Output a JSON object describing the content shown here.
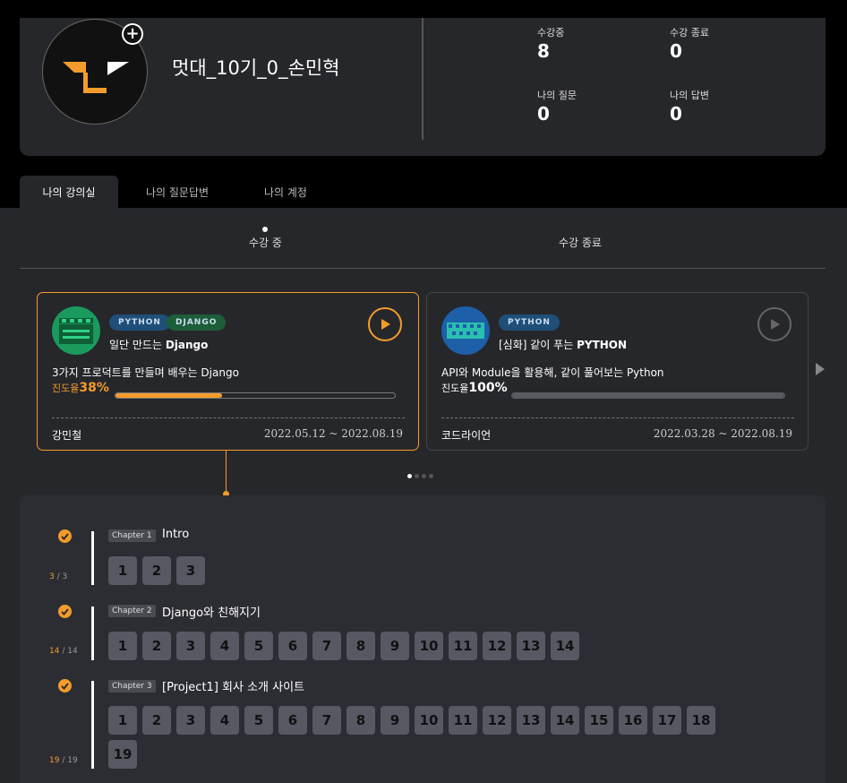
{
  "profile": {
    "nickname": "멋대_10기_0_손민혁",
    "stats": [
      {
        "label": "수강중",
        "value": "8"
      },
      {
        "label": "수강 종료",
        "value": "0"
      },
      {
        "label": "나의 질문",
        "value": "0"
      },
      {
        "label": "나의 답변",
        "value": "0"
      }
    ]
  },
  "tabs": [
    "나의 강의실",
    "나의 질문답변",
    "나의 계정"
  ],
  "subtabs": [
    "수강 중",
    "수강 종료"
  ],
  "courses": [
    {
      "tags": [
        "PYTHON",
        "DJANGO"
      ],
      "title_prefix": "일단 만드는 ",
      "title_bold": "Django",
      "desc": "3가지 프로덕트를 만들며 배우는 Django",
      "progress_label": "진도율",
      "progress_pct": "38%",
      "progress_value": 38,
      "instructor": "강민철",
      "period": "2022.05.12 ~ 2022.08.19",
      "accent": "#f39c2b"
    },
    {
      "tags": [
        "PYTHON"
      ],
      "title_prefix": "[심화] 같이 푸는 ",
      "title_bold": "PYTHON",
      "desc": "API와 Module을 활용해, 같이 풀어보는 Python",
      "progress_label": "진도율",
      "progress_pct": "100%",
      "progress_value": 100,
      "instructor": "코드라이언",
      "period": "2022.03.28 ~ 2022.08.19",
      "accent": "#5a5b61"
    }
  ],
  "chapters": [
    {
      "tag": "Chapter 1",
      "title": "Intro",
      "done": "3",
      "total": "3",
      "lessons": [
        "1",
        "2",
        "3"
      ]
    },
    {
      "tag": "Chapter 2",
      "title": "Django와 친해지기",
      "done": "14",
      "total": "14",
      "lessons": [
        "1",
        "2",
        "3",
        "4",
        "5",
        "6",
        "7",
        "8",
        "9",
        "10",
        "11",
        "12",
        "13",
        "14"
      ]
    },
    {
      "tag": "Chapter 3",
      "title": "[Project1] 회사 소개 사이트",
      "done": "19",
      "total": "19",
      "lessons": [
        "1",
        "2",
        "3",
        "4",
        "5",
        "6",
        "7",
        "8",
        "9",
        "10",
        "11",
        "12",
        "13",
        "14",
        "15",
        "16",
        "17",
        "18",
        "19"
      ]
    }
  ],
  "colors": {
    "accent": "#f39c2b",
    "tag_python": "#1f4e79",
    "tag_django": "#1d5e3a"
  }
}
